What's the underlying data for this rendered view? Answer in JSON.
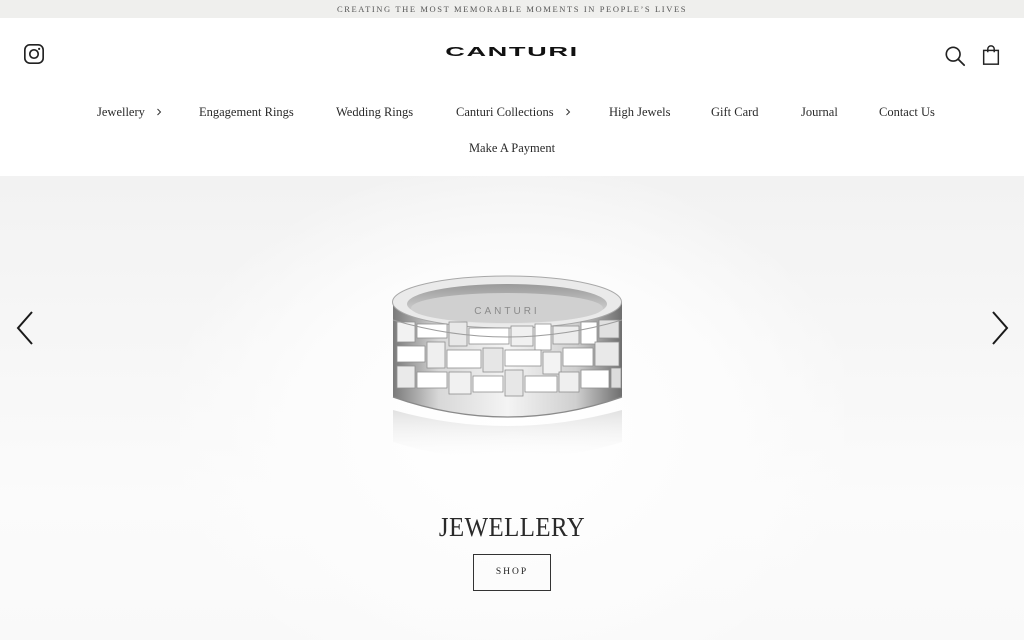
{
  "announcement": "CREATING THE MOST MEMORABLE MOMENTS IN PEOPLE’S LIVES",
  "header": {
    "logo": "CANTURI",
    "icons": {
      "instagram": "instagram-icon",
      "search": "search-icon",
      "cart": "shopping-bag-icon"
    }
  },
  "nav": {
    "items": [
      {
        "label": "Jewellery",
        "has_submenu": true
      },
      {
        "label": "Engagement Rings",
        "has_submenu": false
      },
      {
        "label": "Wedding Rings",
        "has_submenu": false
      },
      {
        "label": "Canturi Collections",
        "has_submenu": true
      },
      {
        "label": "High Jewels",
        "has_submenu": false
      },
      {
        "label": "Gift Card",
        "has_submenu": false
      },
      {
        "label": "Journal",
        "has_submenu": false
      },
      {
        "label": "Contact Us",
        "has_submenu": false
      },
      {
        "label": "Make A Payment",
        "has_submenu": false
      }
    ]
  },
  "hero": {
    "title": "JEWELLERY",
    "button_label": "SHOP",
    "ring_engraving": "CANTURI",
    "prev_icon": "chevron-left-icon",
    "next_icon": "chevron-right-icon"
  },
  "colors": {
    "text": "#222222",
    "announcement_bg": "#efefed",
    "hero_bg": "#f4f4f4"
  }
}
